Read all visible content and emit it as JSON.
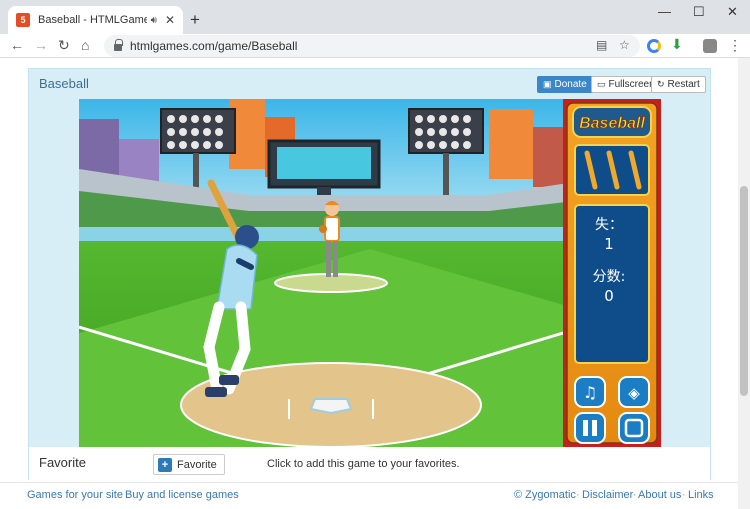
{
  "browser": {
    "tab_title": "Baseball - HTMLGames.com",
    "url": "htmlgames.com/game/Baseball"
  },
  "game_card": {
    "title": "Baseball",
    "donate_label": "Donate",
    "fullscreen_label": "Fullscreen",
    "restart_label": "Restart"
  },
  "game": {
    "logo": "Baseball",
    "outs_label": "失：",
    "outs_value": "1",
    "score_label": "分数:",
    "score_value": "0",
    "bats_remaining": 3
  },
  "favorite": {
    "label": "Favorite",
    "button_label": "Favorite",
    "hint": "Click to add this game to your favorites."
  },
  "footer": {
    "games_for_site": "Games for your site",
    "buy_license": "Buy and license games",
    "zygomatic": "© Zygomatic",
    "disclaimer": "Disclaimer",
    "about": "About us",
    "links": "Links"
  }
}
